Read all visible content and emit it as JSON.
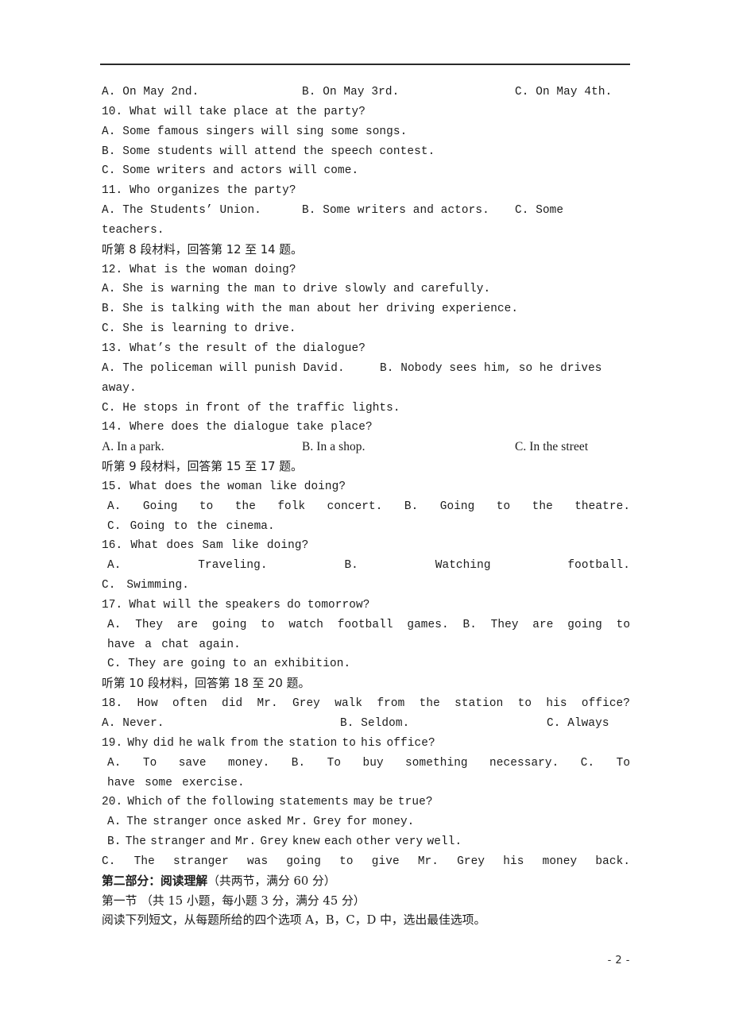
{
  "document": {
    "page_number": "- 2 -",
    "header_rule": true
  },
  "lines": [
    {
      "id": "q9-options",
      "type": "cols",
      "a": "A.  On May 2nd.",
      "b": "B.  On May 3rd.",
      "c": "C.  On May 4th."
    },
    {
      "id": "q10-stem",
      "type": "plain",
      "text": "10.  What will take place at the party?"
    },
    {
      "id": "q10-a",
      "type": "plain",
      "text": "A.  Some famous singers will sing some songs."
    },
    {
      "id": "q10-b",
      "type": "plain",
      "text": "B.  Some students will attend the speech contest."
    },
    {
      "id": "q10-c",
      "type": "plain",
      "text": "C.  Some writers and actors will come."
    },
    {
      "id": "q11-stem",
      "type": "plain",
      "text": "11.  Who organizes the party?"
    },
    {
      "id": "q11-options",
      "type": "cols",
      "a": "A.  The Students’ Union.",
      "b": "B.  Some writers and actors.",
      "c": "C.  Some"
    },
    {
      "id": "q11-c-wrap",
      "type": "plain",
      "text": "teachers."
    },
    {
      "id": "listen-8",
      "type": "zh",
      "text": "听第 8 段材料，回答第 12 至 14 题。"
    },
    {
      "id": "q12-stem",
      "type": "plain",
      "text": "12.  What is the woman doing?"
    },
    {
      "id": "q12-a",
      "type": "plain",
      "text": "A.  She is warning the man to drive slowly and carefully."
    },
    {
      "id": "q12-b",
      "type": "plain",
      "text": "B.  She is talking with the man about her driving experience."
    },
    {
      "id": "q12-c",
      "type": "plain",
      "text": "C.  She is learning to drive."
    },
    {
      "id": "q13-stem",
      "type": "plain",
      "text": "13.  What’s the result of the dialogue?"
    },
    {
      "id": "q13-options-ab",
      "type": "cols-ab",
      "a": "A.  The policeman will punish David.",
      "b": "B.  Nobody sees him, so he drives"
    },
    {
      "id": "q13-b-wrap",
      "type": "plain",
      "text": "away."
    },
    {
      "id": "q13-c",
      "type": "plain",
      "text": "C.  He stops in front of the traffic lights."
    },
    {
      "id": "q14-stem",
      "type": "plain",
      "text": "14.  Where does the dialogue take place?"
    },
    {
      "id": "q14-options",
      "type": "cols-serif",
      "a": "A. In a park.",
      "b": "B. In a shop.",
      "c": "C. In the street"
    },
    {
      "id": "listen-9",
      "type": "zh",
      "text": "听第 9 段材料，回答第 15 至 17 题。"
    },
    {
      "id": "q15-stem",
      "type": "just",
      "words": [
        "15.",
        "What",
        "does",
        "the",
        "woman",
        "like",
        "doing?"
      ],
      "trailing_gap": true
    },
    {
      "id": "q15-options-ab",
      "type": "just",
      "indent": 1,
      "words": [
        "A.",
        "Going",
        "to",
        "the",
        "folk",
        "concert.",
        "B.",
        "Going",
        "to",
        "the",
        "theatre."
      ]
    },
    {
      "id": "q15-c",
      "type": "just",
      "indent": 1,
      "words": [
        "C.",
        "Going",
        "to",
        "the",
        "cinema."
      ],
      "trailing_gap": true
    },
    {
      "id": "q16-stem",
      "type": "just",
      "words": [
        "16.",
        "What",
        "does",
        "Sam",
        "like",
        "doing?"
      ],
      "trailing_gap": true
    },
    {
      "id": "q16-options-ab",
      "type": "just",
      "indent": 1,
      "words": [
        "A.",
        "Traveling.",
        "B.",
        "Watching",
        "football."
      ]
    },
    {
      "id": "q16-c",
      "type": "just",
      "words": [
        "C.",
        "Swimming."
      ],
      "trailing_gap": true
    },
    {
      "id": "q17-stem",
      "type": "just",
      "words": [
        "17.",
        "What",
        "will",
        "the",
        "speakers",
        "do",
        "tomorrow?"
      ],
      "trailing_gap": true
    },
    {
      "id": "q17-options-ab",
      "type": "just",
      "indent": 1,
      "words": [
        "A.",
        "They",
        "are",
        "going",
        "to",
        "watch",
        "football",
        "games.",
        "B.",
        "They",
        "are",
        "going",
        "to"
      ]
    },
    {
      "id": "q17-b-wrap",
      "type": "just",
      "indent": 1,
      "words": [
        "have",
        "a",
        "chat",
        "again."
      ],
      "trailing_gap": true
    },
    {
      "id": "q17-c",
      "type": "just",
      "indent": 1,
      "words": [
        "C.",
        "They",
        "are",
        "going",
        "to",
        "an",
        "exhibition."
      ],
      "trailing_gap": true
    },
    {
      "id": "listen-10",
      "type": "zh",
      "text": "听第 10 段材料，回答第 18 至 20 题。"
    },
    {
      "id": "q18-stem",
      "type": "just",
      "words": [
        "18.",
        "How",
        "often",
        "did",
        "Mr.",
        "Grey",
        "walk",
        "from",
        "the",
        "station",
        "to",
        "his",
        "office?"
      ]
    },
    {
      "id": "q18-options",
      "type": "cols-wide",
      "a": "A.  Never.",
      "b": "B.  Seldom.",
      "c": "C.  Always"
    },
    {
      "id": "q19-stem",
      "type": "just",
      "words": [
        "19.",
        "Why",
        "did",
        "he",
        "walk",
        "from",
        "the",
        "station",
        "to",
        "his",
        "office?"
      ],
      "trailing_gap": true
    },
    {
      "id": "q19-options-abc",
      "type": "just",
      "indent": 1,
      "words": [
        "A.",
        "To",
        "save",
        "money.",
        "B.",
        "To",
        "buy",
        "something",
        "necessary.",
        "C.",
        "To"
      ]
    },
    {
      "id": "q19-c-wrap",
      "type": "just",
      "indent": 1,
      "words": [
        "have",
        "some",
        "exercise."
      ],
      "trailing_gap": true
    },
    {
      "id": "q20-stem",
      "type": "just",
      "words": [
        "20.",
        "Which",
        "of",
        "the",
        "following",
        "statements",
        "may",
        "be",
        "true?"
      ],
      "trailing_gap": true
    },
    {
      "id": "q20-a",
      "type": "just",
      "indent": 1,
      "words": [
        "A.",
        "The",
        "stranger",
        "once",
        "asked",
        "Mr.",
        "Grey",
        "for",
        "money."
      ],
      "trailing_gap": true
    },
    {
      "id": "q20-b",
      "type": "just",
      "indent": 1,
      "words": [
        "B.",
        "The",
        "stranger",
        "and",
        "Mr.",
        "Grey",
        "knew",
        "each",
        "other",
        "very",
        "well."
      ],
      "trailing_gap": true
    },
    {
      "id": "q20-c",
      "type": "just",
      "words": [
        "C.",
        "The",
        "stranger",
        "was",
        "going",
        "to",
        "give",
        "Mr.",
        "Grey",
        "his",
        "money",
        "back."
      ]
    }
  ],
  "section_two": {
    "heading_bold": "第二部分：阅读理解",
    "heading_rest": "（共两节，满分 60 分）",
    "subsection": "第一节 （共 15 小题，每小题 3 分，满分 45 分）",
    "instruction": "阅读下列短文，从每题所给的四个选项 A，B，C，D 中，选出最佳选项。"
  }
}
